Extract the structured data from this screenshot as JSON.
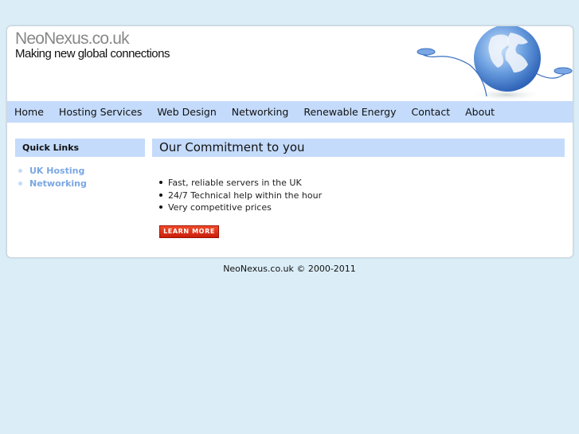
{
  "header": {
    "site_title": "NeoNexus.co.uk",
    "tagline": "Making new global connections"
  },
  "nav": {
    "items": [
      "Home",
      "Hosting Services",
      "Web Design",
      "Networking",
      "Renewable Energy",
      "Contact",
      "About"
    ]
  },
  "sidebar": {
    "heading": "Quick Links",
    "links": [
      "UK Hosting",
      "Networking"
    ]
  },
  "main": {
    "heading": "Our Commitment to you",
    "features": [
      "Fast, reliable servers in the UK",
      "24/7 Technical help within the hour",
      "Very competitive prices"
    ],
    "cta_label": "LEARN MORE"
  },
  "footer": {
    "text": "NeoNexus.co.uk © 2000-2011"
  },
  "colors": {
    "page_background": "#dbeef8",
    "nav_background": "#c4dbfb",
    "link": "#7aa7e3",
    "cta": "#e0341a"
  },
  "icons": {
    "header_art": "globe-with-computer-mice-icon"
  }
}
